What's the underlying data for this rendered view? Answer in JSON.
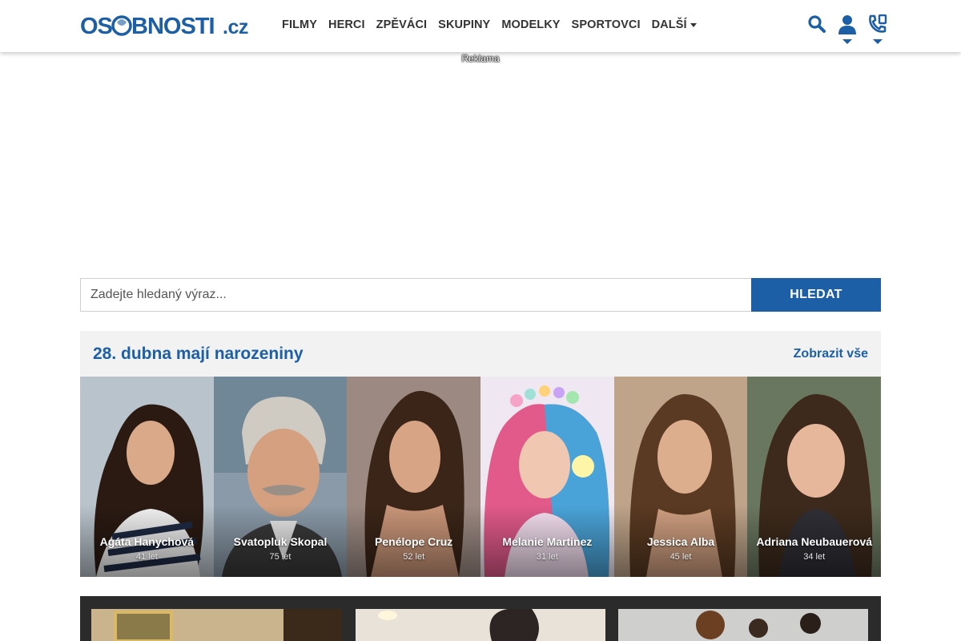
{
  "header": {
    "logo": "OSOBNOSTI.cz",
    "nav": [
      "FILMY",
      "HERCI",
      "ZPĚVÁCI",
      "SKUPINY",
      "MODELKY",
      "SPORTOVCI",
      "DALŠÍ"
    ],
    "icons": [
      "search-icon",
      "user-icon",
      "phone-icon"
    ]
  },
  "ad": {
    "label": "Reklama"
  },
  "search": {
    "placeholder": "Zadejte hledaný výraz...",
    "button": "HLEDAT"
  },
  "birthdays": {
    "title": "28. dubna mají narozeniny",
    "show_all": "Zobrazit vše",
    "people": [
      {
        "name": "Agáta Hanychová",
        "age": "41 let"
      },
      {
        "name": "Svatopluk Skopal",
        "age": "75 let"
      },
      {
        "name": "Penélope Cruz",
        "age": "52 let"
      },
      {
        "name": "Melanie Martinez",
        "age": "31 let"
      },
      {
        "name": "Jessica Alba",
        "age": "45 let"
      },
      {
        "name": "Adriana Neubauerová",
        "age": "34 let"
      }
    ]
  },
  "colors": {
    "brand": "#1d5fa6",
    "panel": "#f2f2f2",
    "dark": "#2b2b2b"
  }
}
